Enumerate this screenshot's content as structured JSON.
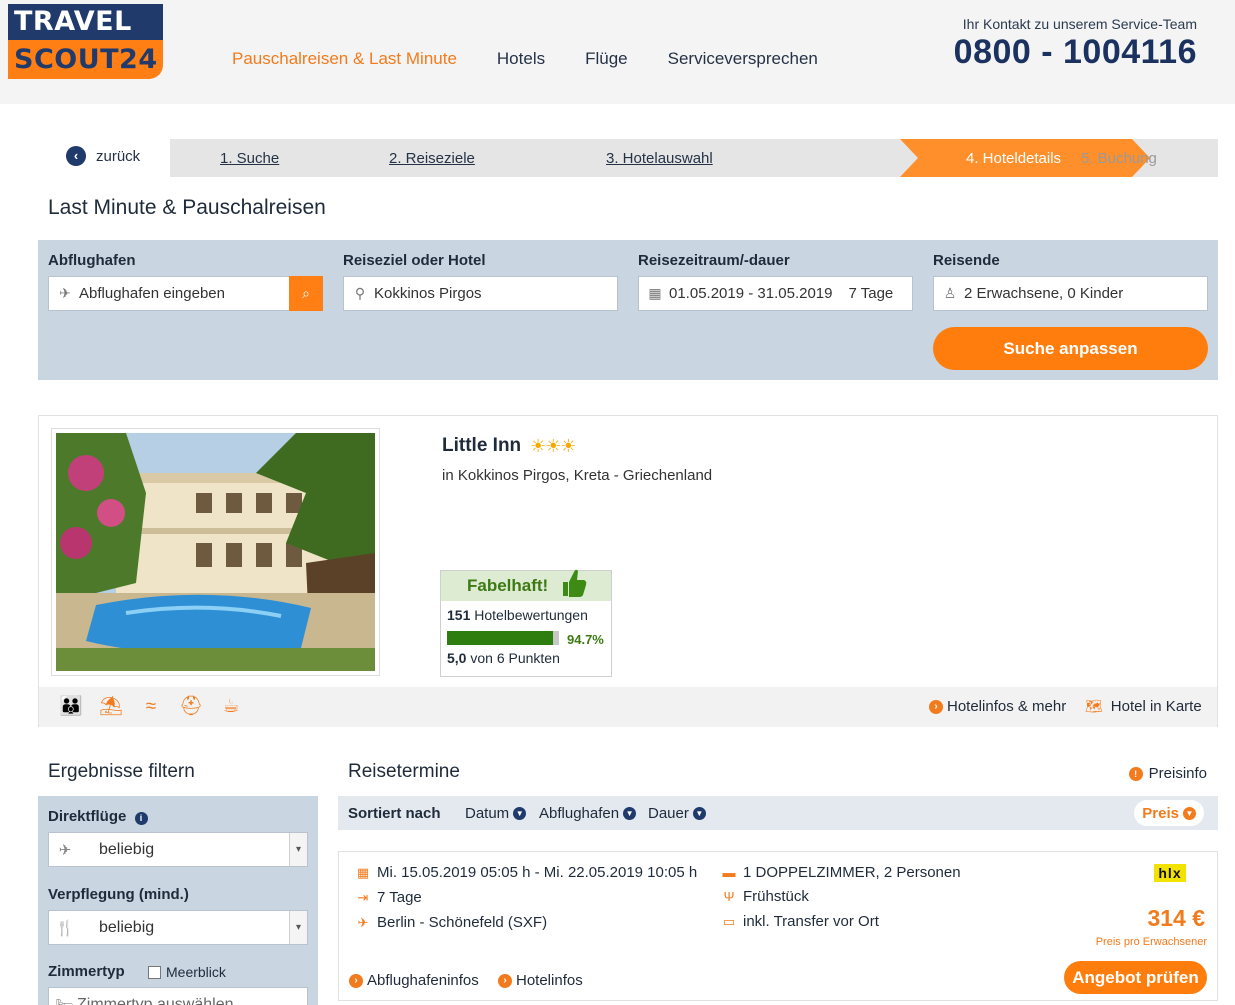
{
  "header": {
    "logo_line1": "TRAVEL",
    "logo_line2": "SCOUT24",
    "nav": [
      "Pauschalreisen & Last Minute",
      "Hotels",
      "Flüge",
      "Serviceversprechen"
    ],
    "contact_label": "Ihr Kontakt zu unserem Service-Team",
    "contact_phone": "0800 - 1004116"
  },
  "steps": {
    "back": "zurück",
    "items": [
      "1. Suche",
      "2. Reiseziele",
      "3. Hotelauswahl",
      "4. Hoteldetails",
      "5. Buchung"
    ]
  },
  "section_title": "Last Minute & Pauschalreisen",
  "search": {
    "airport_label": "Abflughafen",
    "airport_placeholder": "Abflughafen eingeben",
    "destination_label": "Reiseziel oder Hotel",
    "destination_value": "Kokkinos Pirgos",
    "period_label": "Reisezeitraum/-dauer",
    "period_value": "01.05.2019 - 31.05.2019",
    "duration_value": "7 Tage",
    "travelers_label": "Reisende",
    "travelers_value": "2 Erwachsene, 0 Kinder",
    "submit_label": "Suche anpassen"
  },
  "hotel": {
    "name": "Little Inn",
    "stars": "☀☀☀",
    "location": "in Kokkinos Pirgos, Kreta - Griechenland",
    "rating_label": "Fabelhaft!",
    "review_count": "151",
    "review_text": "Hotelbewertungen",
    "recommendation_pct": "94.7%",
    "recommendation_value": 0.947,
    "score": "5,0",
    "score_text": "von 6 Punkten",
    "link_infos": "Hotelinfos & mehr",
    "link_map": "Hotel in Karte"
  },
  "filter": {
    "title": "Ergebnisse filtern",
    "direct_label": "Direktflüge",
    "direct_value": "beliebig",
    "board_label": "Verpflegung (mind.)",
    "board_value": "beliebig",
    "room_label": "Zimmertyp",
    "sea_view_label": "Meerblick",
    "room_placeholder": "Zimmertyp auswählen"
  },
  "results": {
    "title": "Reisetermine",
    "price_info": "Preisinfo",
    "sort_label": "Sortiert nach",
    "sort_options": [
      "Datum",
      "Abflughafen",
      "Dauer"
    ],
    "sort_active": "Preis"
  },
  "offer": {
    "dates": "Mi. 15.05.2019 05:05 h - Mi. 22.05.2019 10:05 h",
    "duration": "7 Tage",
    "airport": "Berlin - Schönefeld (SXF)",
    "room": "1 DOPPELZIMMER, 2 Personen",
    "board": "Frühstück",
    "transfer": "inkl. Transfer vor Ort",
    "operator": "hlx",
    "price": "314 €",
    "price_note": "Preis pro Erwachsener",
    "link_airport": "Abflughafeninfos",
    "link_hotel": "Hotelinfos",
    "cta": "Angebot prüfen"
  },
  "colors": {
    "brand_navy": "#1f3a6b",
    "brand_orange": "#ff7f15",
    "search_panel": "#c9d6e2",
    "rating_green": "#2e7d0f"
  }
}
